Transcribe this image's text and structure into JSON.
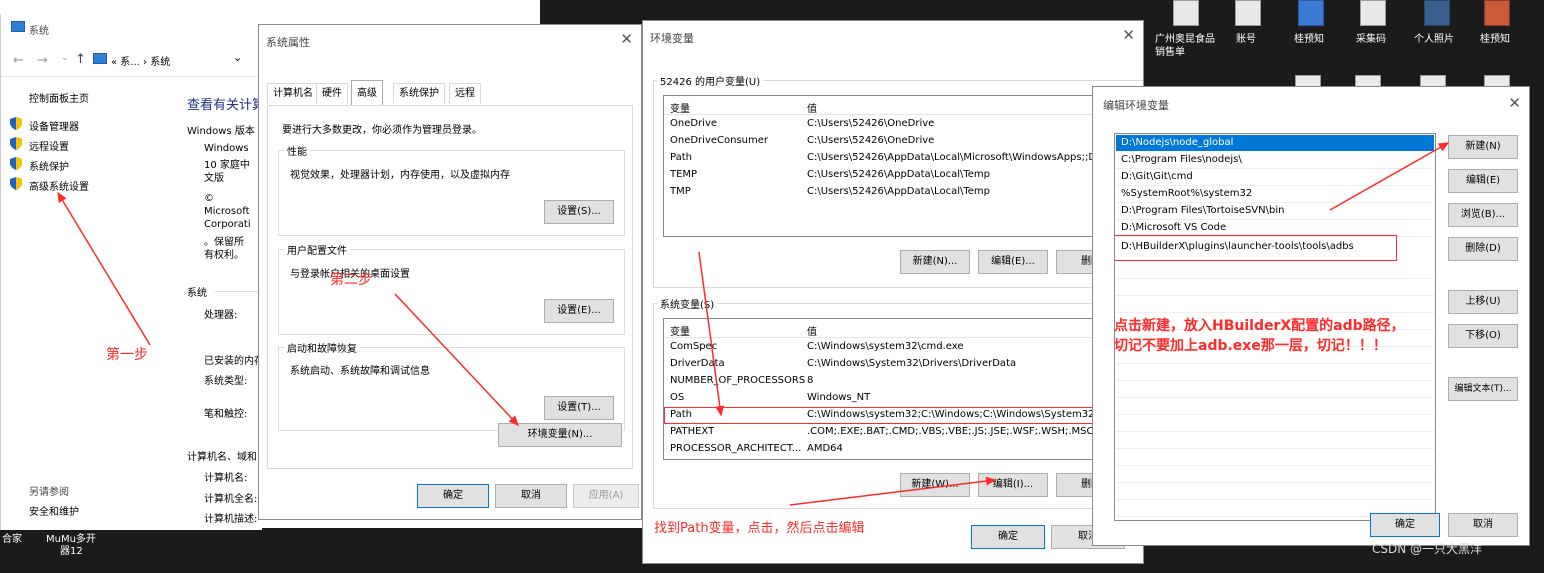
{
  "colors": {
    "annotation": "#ff2a2a",
    "selection": "#0078d7",
    "desktop": "#1b1b1b"
  },
  "taskbar": {
    "text1": "MuMu多开",
    "text2": "器12",
    "text0": "合家"
  },
  "desktop": {
    "icons": [
      {
        "name": "document-icon",
        "label": "广州奥昆食品销售单"
      },
      {
        "name": "document-icon",
        "label": "账号"
      },
      {
        "name": "document-icon",
        "label": "桂预知"
      },
      {
        "name": "document-icon",
        "label": "采集码"
      },
      {
        "name": "document-icon",
        "label": "个人照片"
      },
      {
        "name": "document-icon",
        "label": "桂预知"
      }
    ]
  },
  "system_window": {
    "title": "系统",
    "nav": {
      "back": "←",
      "forward": "→",
      "up": "↑",
      "path": "« 系... › 系统",
      "dropdown": "⌄"
    },
    "sidebar": {
      "home": "控制面板主页",
      "links": [
        "设备管理器",
        "远程设置",
        "系统保护",
        "高级系统设置"
      ],
      "see_also": "另请参阅",
      "security": "安全和维护"
    },
    "main": {
      "heading": "查看有关计算",
      "edition_label": "Windows 版本",
      "edition_lines": [
        "Windows",
        "10 家庭中",
        "文版"
      ],
      "copyright_lines": [
        "©",
        "Microsoft",
        "Corporati",
        "。保留所",
        "有权利。"
      ],
      "system_label": "系统",
      "processor": "处理器:",
      "memory": "已安装的内存",
      "system_type": "系统类型:",
      "pen": "笔和触控:",
      "computer_section": "计算机名、域和",
      "computer_name": "计算机名:",
      "full_name": "计算机全名:",
      "description": "计算机描述:"
    }
  },
  "sysprops_window": {
    "title": "系统属性",
    "close": "✕",
    "tabs": [
      "计算机名",
      "硬件",
      "高级",
      "系统保护",
      "远程"
    ],
    "note": "要进行大多数更改，你必须作为管理员登录。",
    "performance": {
      "label": "性能",
      "desc": "视觉效果，处理器计划，内存使用，以及虚拟内存",
      "button": "设置(S)..."
    },
    "profiles": {
      "label": "用户配置文件",
      "desc": "与登录帐户相关的桌面设置",
      "button": "设置(E)..."
    },
    "startup": {
      "label": "启动和故障恢复",
      "desc": "系统启动、系统故障和调试信息",
      "button": "设置(T)..."
    },
    "env_button": "环境变量(N)...",
    "ok": "确定",
    "cancel": "取消",
    "apply": "应用(A)"
  },
  "env_window": {
    "title": "环境变量",
    "close": "✕",
    "user_section": "52426 的用户变量(U)",
    "col_var": "变量",
    "col_val": "值",
    "user_vars": [
      {
        "name": "OneDrive",
        "value": "C:\\Users\\52426\\OneDrive"
      },
      {
        "name": "OneDriveConsumer",
        "value": "C:\\Users\\52426\\OneDrive"
      },
      {
        "name": "Path",
        "value": "C:\\Users\\52426\\AppData\\Local\\Microsoft\\WindowsApps;;D:"
      },
      {
        "name": "TEMP",
        "value": "C:\\Users\\52426\\AppData\\Local\\Temp"
      },
      {
        "name": "TMP",
        "value": "C:\\Users\\52426\\AppData\\Local\\Temp"
      }
    ],
    "user_buttons": {
      "new": "新建(N)...",
      "edit": "编辑(E)...",
      "delete": "删除"
    },
    "sys_section": "系统变量(S)",
    "sys_vars": [
      {
        "name": "ComSpec",
        "value": "C:\\Windows\\system32\\cmd.exe"
      },
      {
        "name": "DriverData",
        "value": "C:\\Windows\\System32\\Drivers\\DriverData"
      },
      {
        "name": "NUMBER_OF_PROCESSORS",
        "value": "8"
      },
      {
        "name": "OS",
        "value": "Windows_NT"
      },
      {
        "name": "Path",
        "value": "C:\\Windows\\system32;C:\\Windows;C:\\Windows\\System32\\W"
      },
      {
        "name": "PATHEXT",
        "value": ".COM;.EXE;.BAT;.CMD;.VBS;.VBE;.JS;.JSE;.WSF;.WSH;.MSC"
      },
      {
        "name": "PROCESSOR_ARCHITECT...",
        "value": "AMD64"
      }
    ],
    "sys_buttons": {
      "new": "新建(W)...",
      "edit": "编辑(I)...",
      "delete": "删除"
    },
    "ok": "确定",
    "cancel": "取消"
  },
  "edit_env_window": {
    "title": "编辑环境变量",
    "close": "✕",
    "entries": [
      "D:\\Nodejs\\node_global",
      "C:\\Program Files\\nodejs\\",
      "D:\\Git\\Git\\cmd",
      "%SystemRoot%\\system32",
      "D:\\Program Files\\TortoiseSVN\\bin",
      "D:\\Microsoft VS Code",
      "D:\\HBuilderX\\plugins\\launcher-tools\\tools\\adbs"
    ],
    "buttons": [
      "新建(N)",
      "编辑(E)",
      "浏览(B)...",
      "删除(D)",
      "上移(U)",
      "下移(O)",
      "编辑文本(T)..."
    ],
    "ok": "确定",
    "cancel": "取消"
  },
  "annotations": {
    "step1": "第一步",
    "step2": "第二步",
    "find_path": "找到Path变量，点击，然后点击编辑",
    "new_line1": "点击新建，放入HBuilderX配置的adb路径，",
    "new_line2": "切记不要加上adb.exe那一层，切记！！！",
    "watermark": "CSDN @一只大黑洋"
  }
}
